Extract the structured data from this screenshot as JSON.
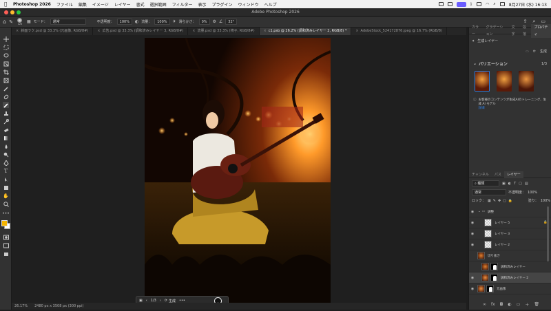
{
  "menubar": {
    "app": "Photoshop 2026",
    "items": [
      "ファイル",
      "編集",
      "イメージ",
      "レイヤー",
      "書式",
      "選択範囲",
      "フィルター",
      "表示",
      "プラグイン",
      "ウィンドウ",
      "ヘルプ"
    ],
    "datetime": "8月27日 (水) 16:13"
  },
  "titlebar": {
    "title": "Adobe Photoshop 2026"
  },
  "options": {
    "mode_label": "モード：",
    "mode_value": "通常",
    "opacity_label": "不透明度：",
    "opacity_value": "100%",
    "flow_label": "流量：",
    "flow_value": "100%",
    "smoothing_label": "滑らかさ：",
    "smoothing_value": "0%",
    "angle_value": "32°",
    "brush_size": "125"
  },
  "tabs": [
    {
      "label": "斜面ラク.psd @ 33.3% (元画像, RGB/8#)"
    },
    {
      "label": "広告.psd @ 33.3% (調和済みレイヤー 3, RGB/8#)"
    },
    {
      "label": "流量.psd @ 33.3% (椅子, RGB/8#)"
    },
    {
      "label": "c1.psb @ 26.2% (調和済みレイヤー 2, RGB/8) *"
    },
    {
      "label": "AdobeStock_524172876.jpeg @ 16.7% (RGB/8)"
    }
  ],
  "context_bar": {
    "page": "1/3",
    "generate": "生成",
    "more": "•••"
  },
  "status": {
    "zoom": "26.17%",
    "info": "2480 px x 3508 px (300 ppi)"
  },
  "rpanel": {
    "top_tabs": [
      "カラー",
      "グラデーション",
      "文字",
      "段落",
      "プロパティ"
    ],
    "props_layer": "生成レイヤー",
    "generate": "生成",
    "variations_title": "バリエーション",
    "variations_count": "1/3",
    "notice": "お客様のコンテンツが生成AIのトレーニング、生成 AI モデル",
    "notice_link": "詳細",
    "layer_tabs": [
      "チャンネル",
      "パス",
      "レイヤー"
    ],
    "filter_kind": "種類",
    "blend": "通常",
    "opacity_label": "不透明度：",
    "opacity_value": "100%",
    "lock_label": "ロック：",
    "fill_label": "塗り：",
    "fill_value": "100%",
    "layers": [
      {
        "name": "調整"
      },
      {
        "name": "レイヤー 5"
      },
      {
        "name": "レイヤー 3"
      },
      {
        "name": "レイヤー 2"
      },
      {
        "name": "切り抜き"
      },
      {
        "name": "調和済みレイヤー"
      },
      {
        "name": "調和済みレイヤー 2"
      },
      {
        "name": "元画像"
      }
    ]
  },
  "colors": {
    "accent": "#2d7ee0",
    "panel": "#323232",
    "canvasbg": "#1f1f1f"
  }
}
